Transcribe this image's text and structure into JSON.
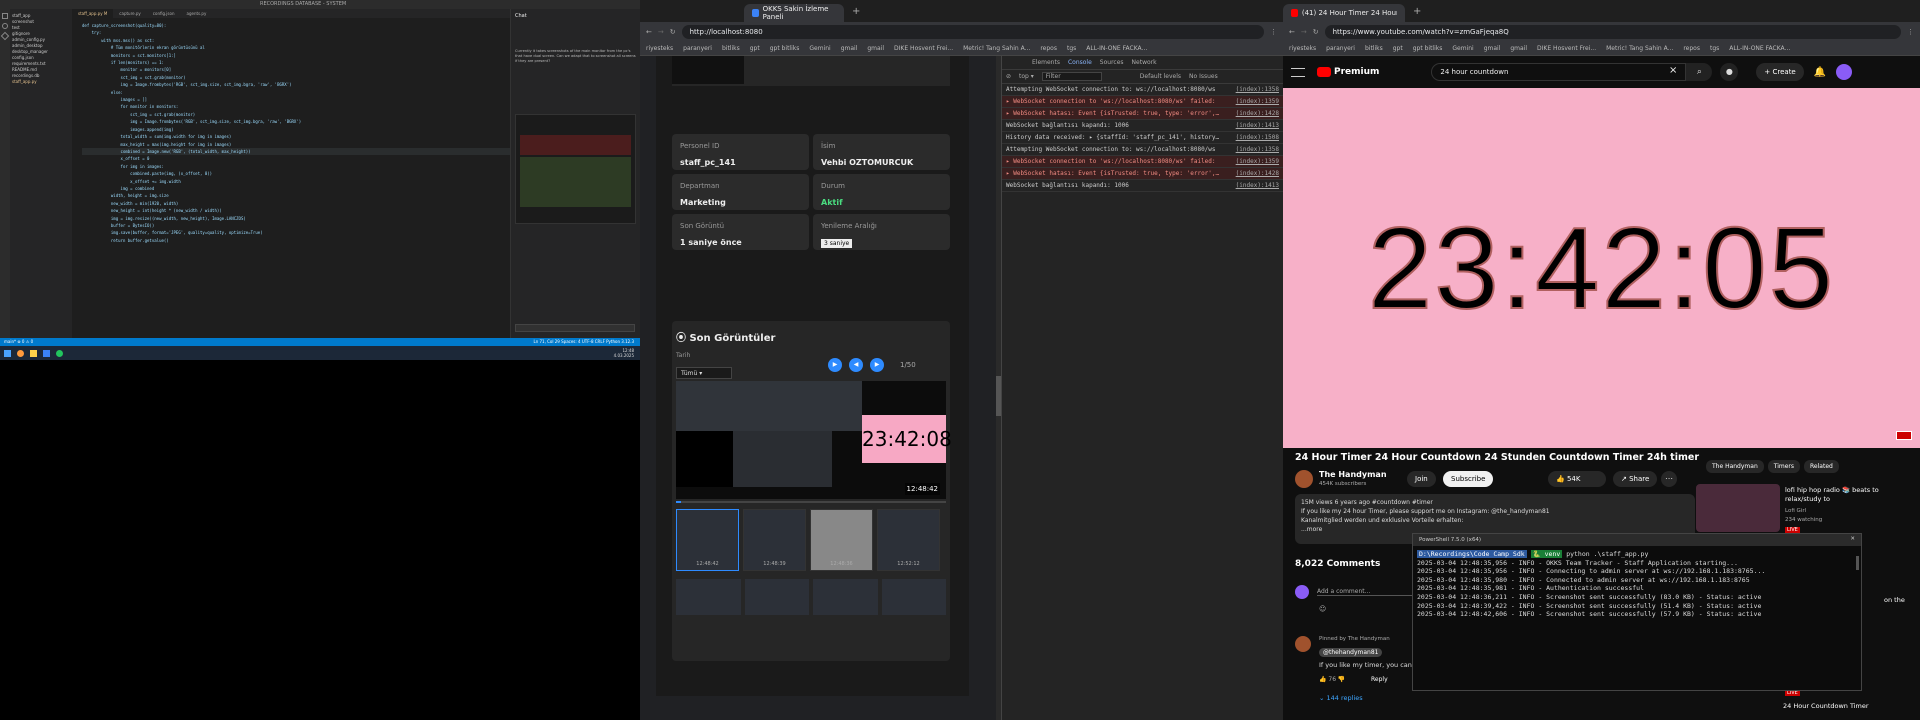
{
  "vscode": {
    "title": "RECORDINGS DATABASE - SYSTEM",
    "tabs": [
      "staff_app.py M",
      "capture.py",
      "config.json",
      "agents.py"
    ],
    "sidebar_files": [
      "staff_app",
      "screenshot",
      "test",
      "gitignore",
      "admin_config.py",
      "admin_desktop",
      "desktop_manager",
      "config.json",
      "requirements.txt",
      "README.md",
      "recordings.db",
      "staff_app.py"
    ],
    "code": [
      "def capture_screenshot(quality=80):",
      "    try:",
      "        with mss.mss() as sct:",
      "            # Tüm monitörlerin ekran görüntüsünü al",
      "            monitors = sct.monitors[1:]",
      "",
      "            if len(monitors) == 1:",
      "                monitor = monitors[0]",
      "                sct_img = sct.grab(monitor)",
      "                img = Image.frombytes('RGB', sct_img.size, sct_img.bgra, 'raw', 'BGRX')",
      "            else:",
      "                images = []",
      "                for monitor in monitors:",
      "                    sct_img = sct.grab(monitor)",
      "                    img = Image.frombytes('RGB', sct_img.size, sct_img.bgra, 'raw', 'BGRX')",
      "                    images.append(img)",
      "",
      "                total_width = sum(img.width for img in images)",
      "                max_height = max(img.height for img in images)",
      "",
      "                combined = Image.new('RGB', (total_width, max_height))",
      "",
      "                x_offset = 0",
      "                for img in images:",
      "                    combined.paste(img, (x_offset, 0))",
      "                    x_offset += img.width",
      "",
      "                img = combined",
      "",
      "            width, height = img.size",
      "            new_width = min(1920, width)",
      "            new_height = int(height * (new_width / width))",
      "            img = img.resize((new_width, new_height), Image.LANCZOS)",
      "",
      "            buffer = BytesIO()",
      "            img.save(buffer, format='JPEG', quality=quality, optimize=True)",
      "            return buffer.getvalue()"
    ],
    "chat_title": "Chat",
    "chat_text": "Currently it takes screenshots of the main monitor from the pc's that have dual screen. Can we adapt that to screenshot all screens if they are present?",
    "status_left": "main* ⊗ 0 ⚠ 0",
    "status_right": "Ln 71, Col 29   Spaces: 4   UTF-8   CRLF   Python 3.12.3"
  },
  "taskbar": {
    "time": "12:48",
    "date": "4.03.2025"
  },
  "okks": {
    "tab_title": "OKKS Sakin İzleme Paneli",
    "url": "http://localhost:8080",
    "bookmarks": [
      "riyesteks",
      "paranyeri",
      "bitliks",
      "gpt",
      "gpt bitliks",
      "Gemini",
      "gmail",
      "gmail",
      "DIKE Hosvent Frei...",
      "Metric! Tang Sahin A...",
      "repos",
      "tgs",
      "ALL-IN-ONE FACKA..."
    ],
    "fields": [
      {
        "label": "Personel ID",
        "value": "staff_pc_141"
      },
      {
        "label": "İsim",
        "value": "Vehbi OZTOMURCUK"
      },
      {
        "label": "Departman",
        "value": "Marketing"
      },
      {
        "label": "Durum",
        "value": "Aktif"
      },
      {
        "label": "Son Görüntü",
        "value": "1 saniye önce"
      },
      {
        "label": "Yenileme Aralığı",
        "value": "3 saniye"
      }
    ],
    "recent_title": "Son Görüntüler",
    "date_label": "Tarih",
    "date_value": "Tümü",
    "counter": "1/50",
    "preview_clock": "23:42:08",
    "preview_time": "12:48:42",
    "thumbs": [
      "12:48:42",
      "12:48:39",
      "12:48:36",
      "12:52:12"
    ]
  },
  "devtools": {
    "tabs": [
      "Elements",
      "Console",
      "Sources",
      "Network"
    ],
    "filter": "Filter",
    "levels": "Default levels",
    "issues": "No Issues",
    "rows": [
      {
        "t": "Attempting WebSocket connection to: ws://localhost:8080/ws",
        "src": "(index):1358",
        "err": false
      },
      {
        "t": "▸ WebSocket connection to 'ws://localhost:8080/ws' failed:",
        "src": "(index):1359",
        "err": true
      },
      {
        "t": "▸ WebSocket hatası: Event {isTrusted: true, type: 'error', target: WebSocket, ...}",
        "src": "(index):1428",
        "err": true
      },
      {
        "t": "WebSocket bağlantısı kapandı: 1006",
        "src": "(index):1413",
        "err": false
      },
      {
        "t": "History data received: ▸ {staffId: 'staff_pc_141', history: Array(50), ...}",
        "src": "(index):1508",
        "err": false
      },
      {
        "t": "Attempting WebSocket connection to: ws://localhost:8080/ws",
        "src": "(index):1358",
        "err": false
      },
      {
        "t": "▸ WebSocket connection to 'ws://localhost:8080/ws' failed:",
        "src": "(index):1359",
        "err": true
      },
      {
        "t": "▸ WebSocket hatası: Event {isTrusted: true, type: 'error', target: WebSocket, ...}",
        "src": "(index):1428",
        "err": true
      },
      {
        "t": "WebSocket bağlantısı kapandı: 1006",
        "src": "(index):1413",
        "err": false
      }
    ]
  },
  "youtube": {
    "tab_title": "(41) 24 Hour Timer 24 Hour C...",
    "url": "https://www.youtube.com/watch?v=zmGaFjeqa8Q",
    "search": "24 hour countdown",
    "logo": "Premium",
    "create": "Create",
    "clock": "23:42:05",
    "video_title": "24 Hour Timer 24 Hour Countdown 24 Stunden Countdown Timer 24h timer",
    "channel": "The Handyman",
    "subs": "454K subscribers",
    "join": "Join",
    "subscribe": "Subscribe",
    "likes": "54K",
    "share": "Share",
    "chips": [
      "The Handyman",
      "Timers",
      "Related"
    ],
    "views": "15M views  6 years ago  #countdown #timer",
    "desc1": "If you like my 24 hour Timer, please support me on Instagram: @the_handyman81",
    "desc2": "Kanalmitglied werden und exklusive Vorteile erhalten:",
    "more": "...more",
    "comments": "8,022 Comments",
    "add_comment": "Add a comment...",
    "pinned": "Pinned by The Handyman",
    "comment_user": "@thehandyman81",
    "comment_text": "If you like my timer, you can",
    "replies": "144 replies",
    "reply": "Reply",
    "side_title": "lofi hip hop radio 📚 beats to relax/study to",
    "side_channel": "Lofi Girl",
    "side_watch": "234 watching",
    "live": "LIVE",
    "side2": "24 Hour Countdown Timer",
    "on_the": "on the"
  },
  "terminal": {
    "title": "PowerShell 7.5.0 (x64)",
    "prompt": "D:\\Recordings\\Code Camp Sdk",
    "cmd": "python .\\staff_app.py",
    "lines": [
      "2025-03-04 12:48:35,956 - INFO - OKKS Team Tracker - Staff Application starting...",
      "2025-03-04 12:48:35,956 - INFO - Connecting to admin server at ws://192.168.1.183:8765...",
      "2025-03-04 12:48:35,980 - INFO - Connected to admin server at ws://192.168.1.183:8765",
      "2025-03-04 12:48:35,981 - INFO - Authentication successful",
      "2025-03-04 12:48:36,211 - INFO - Screenshot sent successfully (83.0 KB) - Status: active",
      "2025-03-04 12:48:39,422 - INFO - Screenshot sent successfully (51.4 KB) - Status: active",
      "2025-03-04 12:48:42,606 - INFO - Screenshot sent successfully (57.9 KB) - Status: active"
    ]
  }
}
